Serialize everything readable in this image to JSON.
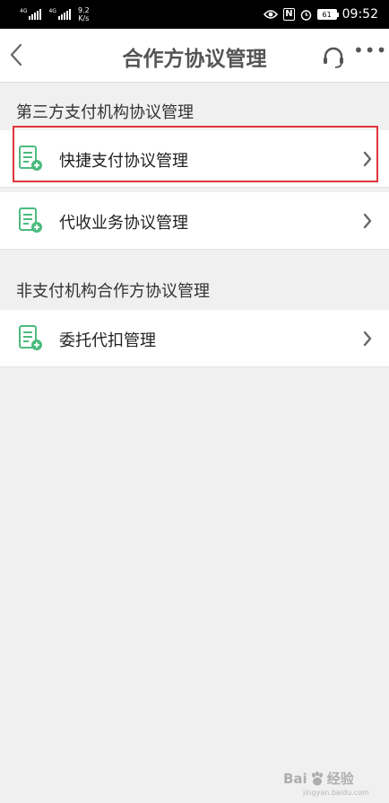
{
  "status_bar": {
    "sim1_label": "4G",
    "sim2_label": "4G",
    "net_speed_value": "9.2",
    "net_speed_unit": "K/s",
    "nfc_label": "N",
    "battery": "61",
    "time": "09:52"
  },
  "header": {
    "title": "合作方协议管理",
    "more_label": "•••"
  },
  "sections": [
    {
      "title": "第三方支付机构协议管理",
      "items": [
        {
          "label": "快捷支付协议管理",
          "highlighted": true
        },
        {
          "label": "代收业务协议管理",
          "highlighted": false
        }
      ]
    },
    {
      "title": "非支付机构合作方协议管理",
      "items": [
        {
          "label": "委托代扣管理",
          "highlighted": false
        }
      ]
    }
  ],
  "watermark": {
    "brand": "Bai",
    "brand_suffix": "经验",
    "sub": "jingyan.baidu.com"
  },
  "colors": {
    "accent_green": "#4cbb7f",
    "highlight_red": "#e0353b",
    "page_bg": "#f0f0f0"
  },
  "icons": {
    "back": "chevron-left-icon",
    "headset": "headset-icon",
    "more": "more-dots-icon",
    "row_icon": "document-add-icon",
    "row_chevron": "chevron-right-icon"
  }
}
